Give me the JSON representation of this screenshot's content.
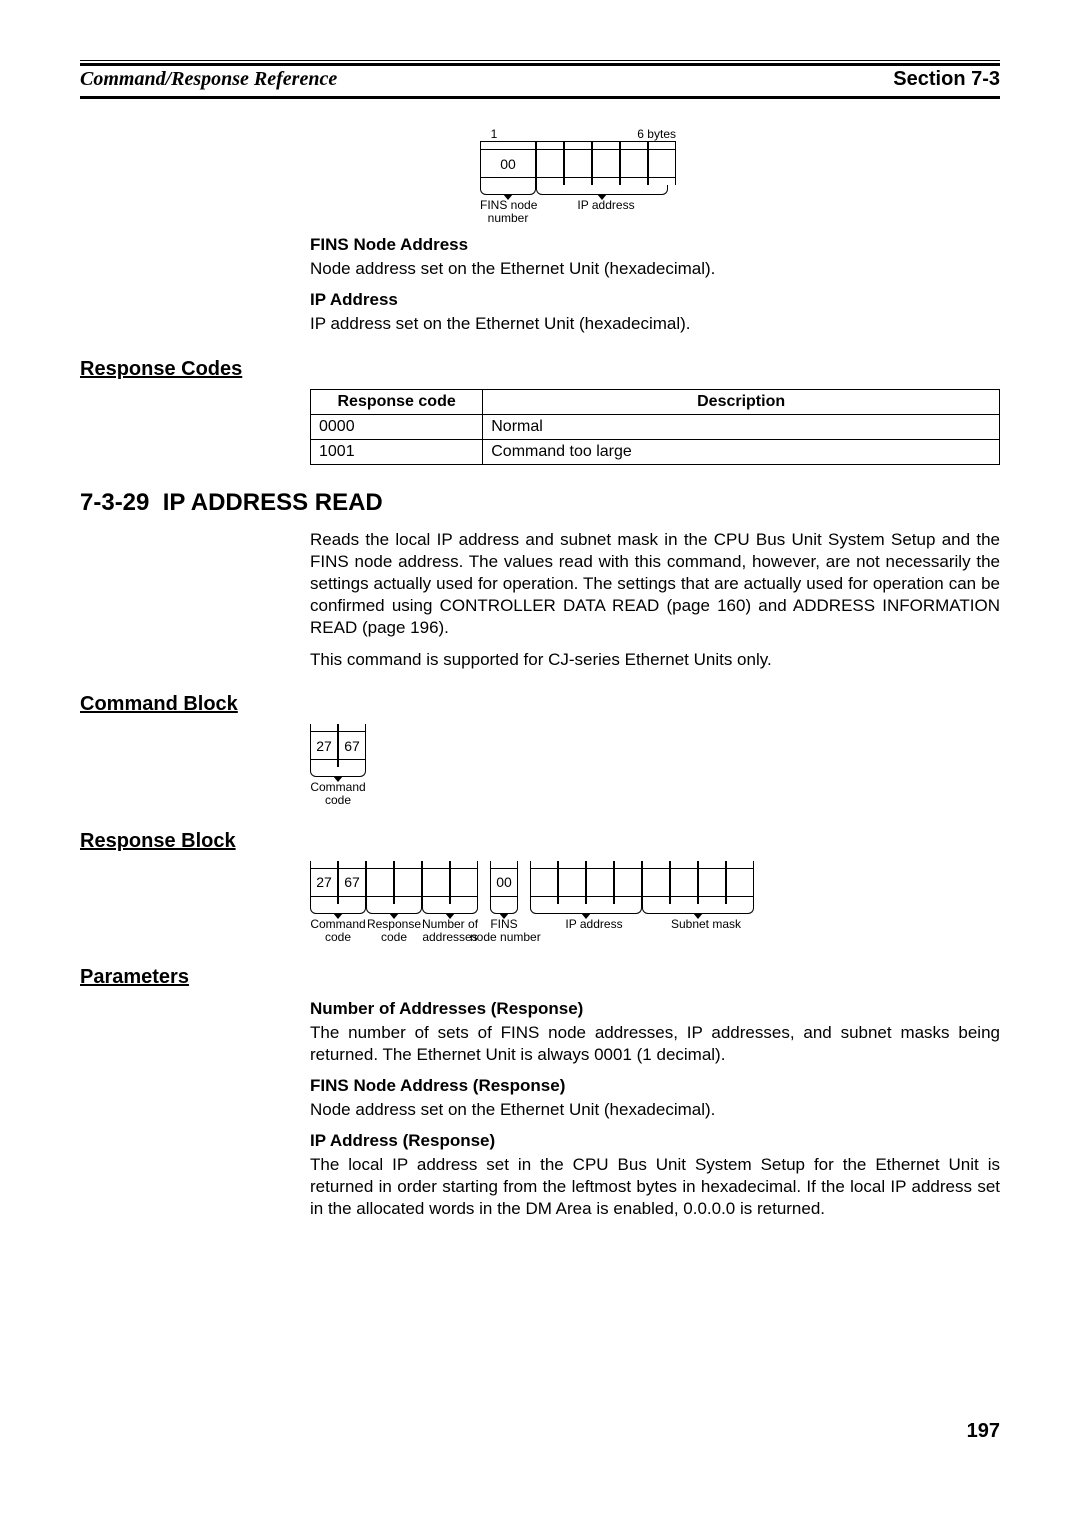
{
  "header": {
    "left": "Command/Response Reference",
    "right": "Section 7-3"
  },
  "diagram1": {
    "left_dim": "1",
    "right_dim": "6 bytes",
    "cell1": "00",
    "label_left": "FINS node\nnumber",
    "label_right": "IP address"
  },
  "param1": {
    "h": "FINS Node Address",
    "t": "Node address set on the Ethernet Unit (hexadecimal)."
  },
  "param2": {
    "h": "IP Address",
    "t": "IP address set on the Ethernet Unit (hexadecimal)."
  },
  "resp_codes_heading": "Response Codes",
  "codes_table": {
    "h1": "Response code",
    "h2": "Description",
    "r1c1": "0000",
    "r1c2": "Normal",
    "r2c1": "1001",
    "r2c2": "Command too large"
  },
  "section": {
    "num": "7-3-29",
    "title": "IP ADDRESS READ",
    "p1": "Reads the local IP address and subnet mask in the CPU Bus Unit System Setup and the FINS node address. The values read with this command, however, are not necessarily the settings actually used for operation. The settings that are actually used for operation can be confirmed using CONTROLLER DATA READ (page 160) and ADDRESS INFORMATION READ (page 196).",
    "p2": "This command is supported for CJ-series Ethernet Units only."
  },
  "cmd_block_heading": "Command Block",
  "cmd_block": {
    "c1": "27",
    "c2": "67",
    "label": "Command\ncode"
  },
  "resp_block_heading": "Response Block",
  "resp_block": {
    "c1": "27",
    "c2": "67",
    "c7": "00",
    "l1": "Command\ncode",
    "l2": "Response\ncode",
    "l3": "Number of\naddresses",
    "l4": "FINS\nnode number",
    "l5": "IP address",
    "l6": "Subnet mask"
  },
  "params_heading": "Parameters",
  "p3": {
    "h": "Number of Addresses (Response)",
    "t": "The number of sets of FINS node addresses, IP addresses, and subnet masks being returned. The Ethernet Unit is always 0001 (1 decimal)."
  },
  "p4": {
    "h": "FINS Node Address (Response)",
    "t": "Node address set on the Ethernet Unit (hexadecimal)."
  },
  "p5": {
    "h": "IP Address (Response)",
    "t": "The local IP address set in the CPU Bus Unit System Setup for the Ethernet Unit is returned in order starting from the leftmost bytes in hexadecimal. If the local IP address set in the allocated words in the DM Area is enabled, 0.0.0.0 is returned."
  },
  "page_number": "197"
}
